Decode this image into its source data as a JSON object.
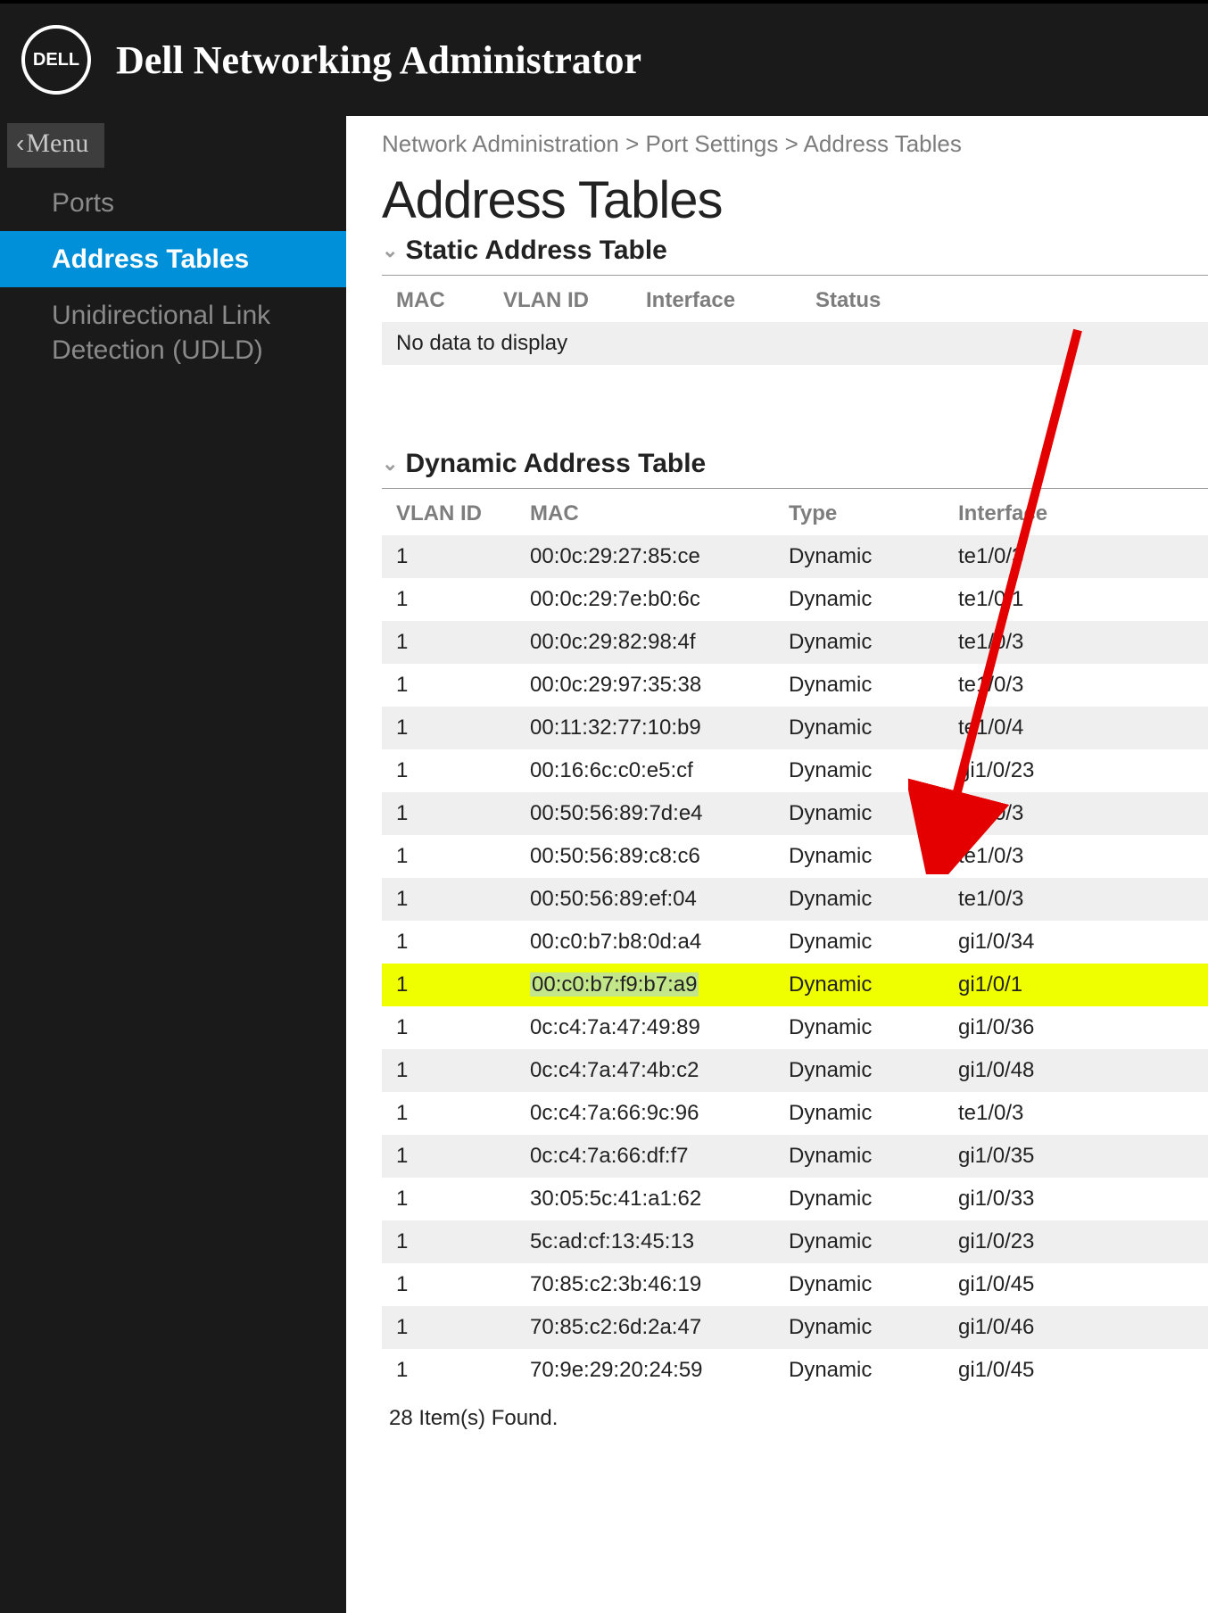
{
  "header": {
    "logo_text": "DELL",
    "app_title": "Dell Networking Administrator"
  },
  "sidebar": {
    "back_label": "Menu",
    "items": [
      {
        "label": "Ports",
        "active": false
      },
      {
        "label": "Address Tables",
        "active": true
      },
      {
        "label": "Unidirectional Link Detection (UDLD)",
        "active": false
      }
    ]
  },
  "breadcrumb": "Network Administration > Port Settings > Address Tables",
  "page_title": "Address Tables",
  "static_table": {
    "title": "Static Address Table",
    "columns": [
      "MAC",
      "VLAN ID",
      "Interface",
      "Status"
    ],
    "empty_text": "No data to display"
  },
  "dynamic_table": {
    "title": "Dynamic Address Table",
    "columns": [
      "VLAN ID",
      "MAC",
      "Type",
      "Interface"
    ],
    "rows": [
      {
        "vlan": "1",
        "mac": "00:0c:29:27:85:ce",
        "type": "Dynamic",
        "iface": "te1/0/3",
        "highlight": false
      },
      {
        "vlan": "1",
        "mac": "00:0c:29:7e:b0:6c",
        "type": "Dynamic",
        "iface": "te1/0/1",
        "highlight": false
      },
      {
        "vlan": "1",
        "mac": "00:0c:29:82:98:4f",
        "type": "Dynamic",
        "iface": "te1/0/3",
        "highlight": false
      },
      {
        "vlan": "1",
        "mac": "00:0c:29:97:35:38",
        "type": "Dynamic",
        "iface": "te1/0/3",
        "highlight": false
      },
      {
        "vlan": "1",
        "mac": "00:11:32:77:10:b9",
        "type": "Dynamic",
        "iface": "te1/0/4",
        "highlight": false
      },
      {
        "vlan": "1",
        "mac": "00:16:6c:c0:e5:cf",
        "type": "Dynamic",
        "iface": "gi1/0/23",
        "highlight": false
      },
      {
        "vlan": "1",
        "mac": "00:50:56:89:7d:e4",
        "type": "Dynamic",
        "iface": "te1/0/3",
        "highlight": false
      },
      {
        "vlan": "1",
        "mac": "00:50:56:89:c8:c6",
        "type": "Dynamic",
        "iface": "te1/0/3",
        "highlight": false
      },
      {
        "vlan": "1",
        "mac": "00:50:56:89:ef:04",
        "type": "Dynamic",
        "iface": "te1/0/3",
        "highlight": false
      },
      {
        "vlan": "1",
        "mac": "00:c0:b7:b8:0d:a4",
        "type": "Dynamic",
        "iface": "gi1/0/34",
        "highlight": false
      },
      {
        "vlan": "1",
        "mac": "00:c0:b7:f9:b7:a9",
        "type": "Dynamic",
        "iface": "gi1/0/1",
        "highlight": true
      },
      {
        "vlan": "1",
        "mac": "0c:c4:7a:47:49:89",
        "type": "Dynamic",
        "iface": "gi1/0/36",
        "highlight": false
      },
      {
        "vlan": "1",
        "mac": "0c:c4:7a:47:4b:c2",
        "type": "Dynamic",
        "iface": "gi1/0/48",
        "highlight": false
      },
      {
        "vlan": "1",
        "mac": "0c:c4:7a:66:9c:96",
        "type": "Dynamic",
        "iface": "te1/0/3",
        "highlight": false
      },
      {
        "vlan": "1",
        "mac": "0c:c4:7a:66:df:f7",
        "type": "Dynamic",
        "iface": "gi1/0/35",
        "highlight": false
      },
      {
        "vlan": "1",
        "mac": "30:05:5c:41:a1:62",
        "type": "Dynamic",
        "iface": "gi1/0/33",
        "highlight": false
      },
      {
        "vlan": "1",
        "mac": "5c:ad:cf:13:45:13",
        "type": "Dynamic",
        "iface": "gi1/0/23",
        "highlight": false
      },
      {
        "vlan": "1",
        "mac": "70:85:c2:3b:46:19",
        "type": "Dynamic",
        "iface": "gi1/0/45",
        "highlight": false
      },
      {
        "vlan": "1",
        "mac": "70:85:c2:6d:2a:47",
        "type": "Dynamic",
        "iface": "gi1/0/46",
        "highlight": false
      },
      {
        "vlan": "1",
        "mac": "70:9e:29:20:24:59",
        "type": "Dynamic",
        "iface": "gi1/0/45",
        "highlight": false
      }
    ],
    "items_found": "28 Item(s) Found."
  }
}
